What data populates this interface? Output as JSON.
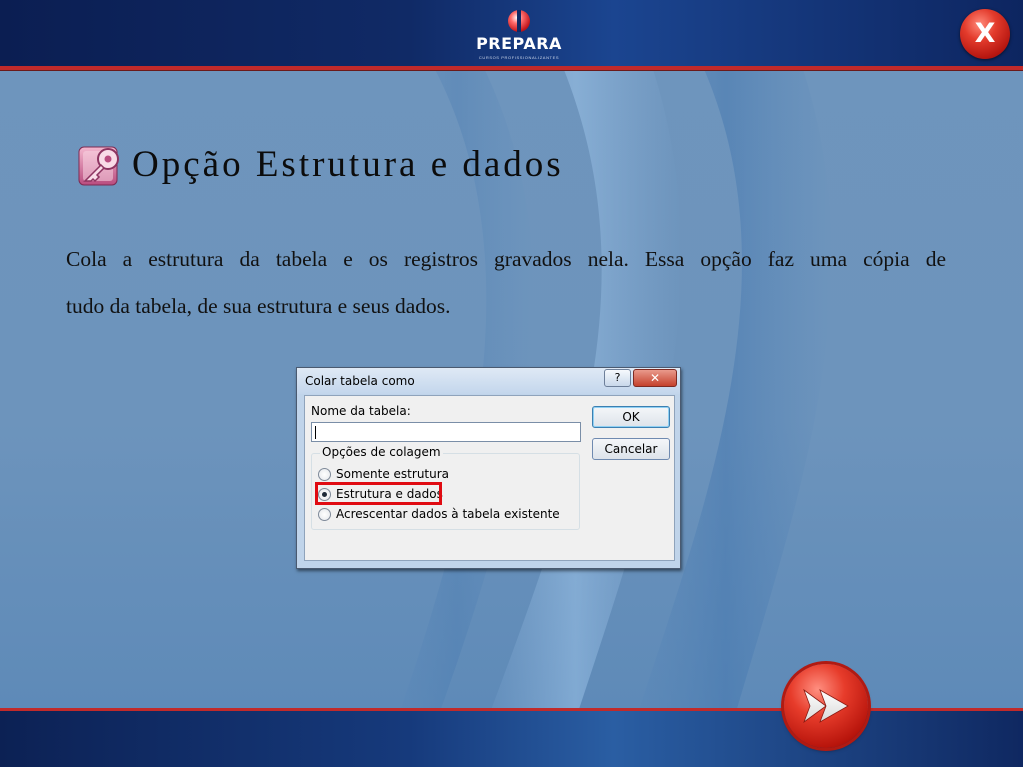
{
  "brand": {
    "name": "PREPARA",
    "tagline": "CURSOS PROFISSIONALIZANTES"
  },
  "nav": {
    "close_label": "X",
    "next_icon": "double-chevron-right-icon"
  },
  "slide": {
    "title": "Opção Estrutura e dados",
    "title_icon": "ms-access-icon",
    "body_lines": [
      "Cola a estrutura da tabela e os registros gravados nela. Essa opção faz uma cópia de",
      "tudo da tabela, de sua estrutura e seus dados."
    ]
  },
  "dialog": {
    "title": "Colar tabela como",
    "help_label": "?",
    "close_label": "✕",
    "name_label": "Nome da tabela:",
    "name_value": "",
    "ok_label": "OK",
    "cancel_label": "Cancelar",
    "options_legend": "Opções de colagem",
    "options": [
      {
        "label": "Somente estrutura",
        "selected": false
      },
      {
        "label": "Estrutura e dados",
        "selected": true
      },
      {
        "label": "Acrescentar dados à tabela existente",
        "selected": false
      }
    ]
  },
  "colors": {
    "background": "#6e95bd",
    "bar_dark": "#0b1e52",
    "accent_red": "#c12a2a",
    "highlight_red": "#e00b12"
  }
}
